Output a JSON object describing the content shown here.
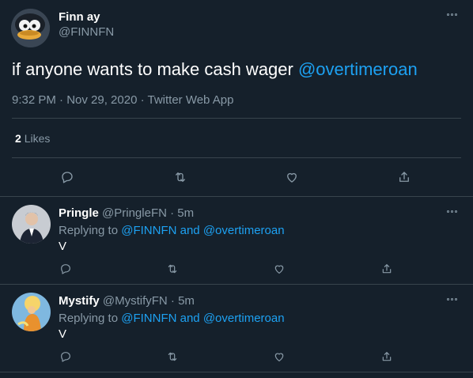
{
  "main_tweet": {
    "display_name": "Finn ay",
    "handle": "@FINNFN",
    "text_prefix": "if anyone wants to make cash wager ",
    "mention": "@overtimeroan",
    "timestamp": "9:32 PM · Nov 29, 2020 · Twitter Web App",
    "likes_count": "2",
    "likes_label": "Likes"
  },
  "replies": [
    {
      "display_name": "Pringle",
      "handle": "@PringleFN",
      "time": "· 5m",
      "replying_to": "Replying to",
      "mention1": "@FINNFN",
      "and": "and",
      "mention2": "@overtimeroan",
      "text": "V"
    },
    {
      "display_name": "Mystify",
      "handle": "@MystifyFN",
      "time": "· 5m",
      "replying_to": "Replying to",
      "mention1": "@FINNFN",
      "and": "and",
      "mention2": "@overtimeroan",
      "text": "V"
    }
  ],
  "colors": {
    "background": "#15202b",
    "link": "#1da1f2",
    "muted": "#8899a6",
    "divider": "#38444d"
  },
  "icons": [
    "reply-icon",
    "retweet-icon",
    "like-icon",
    "share-icon",
    "more-icon"
  ]
}
